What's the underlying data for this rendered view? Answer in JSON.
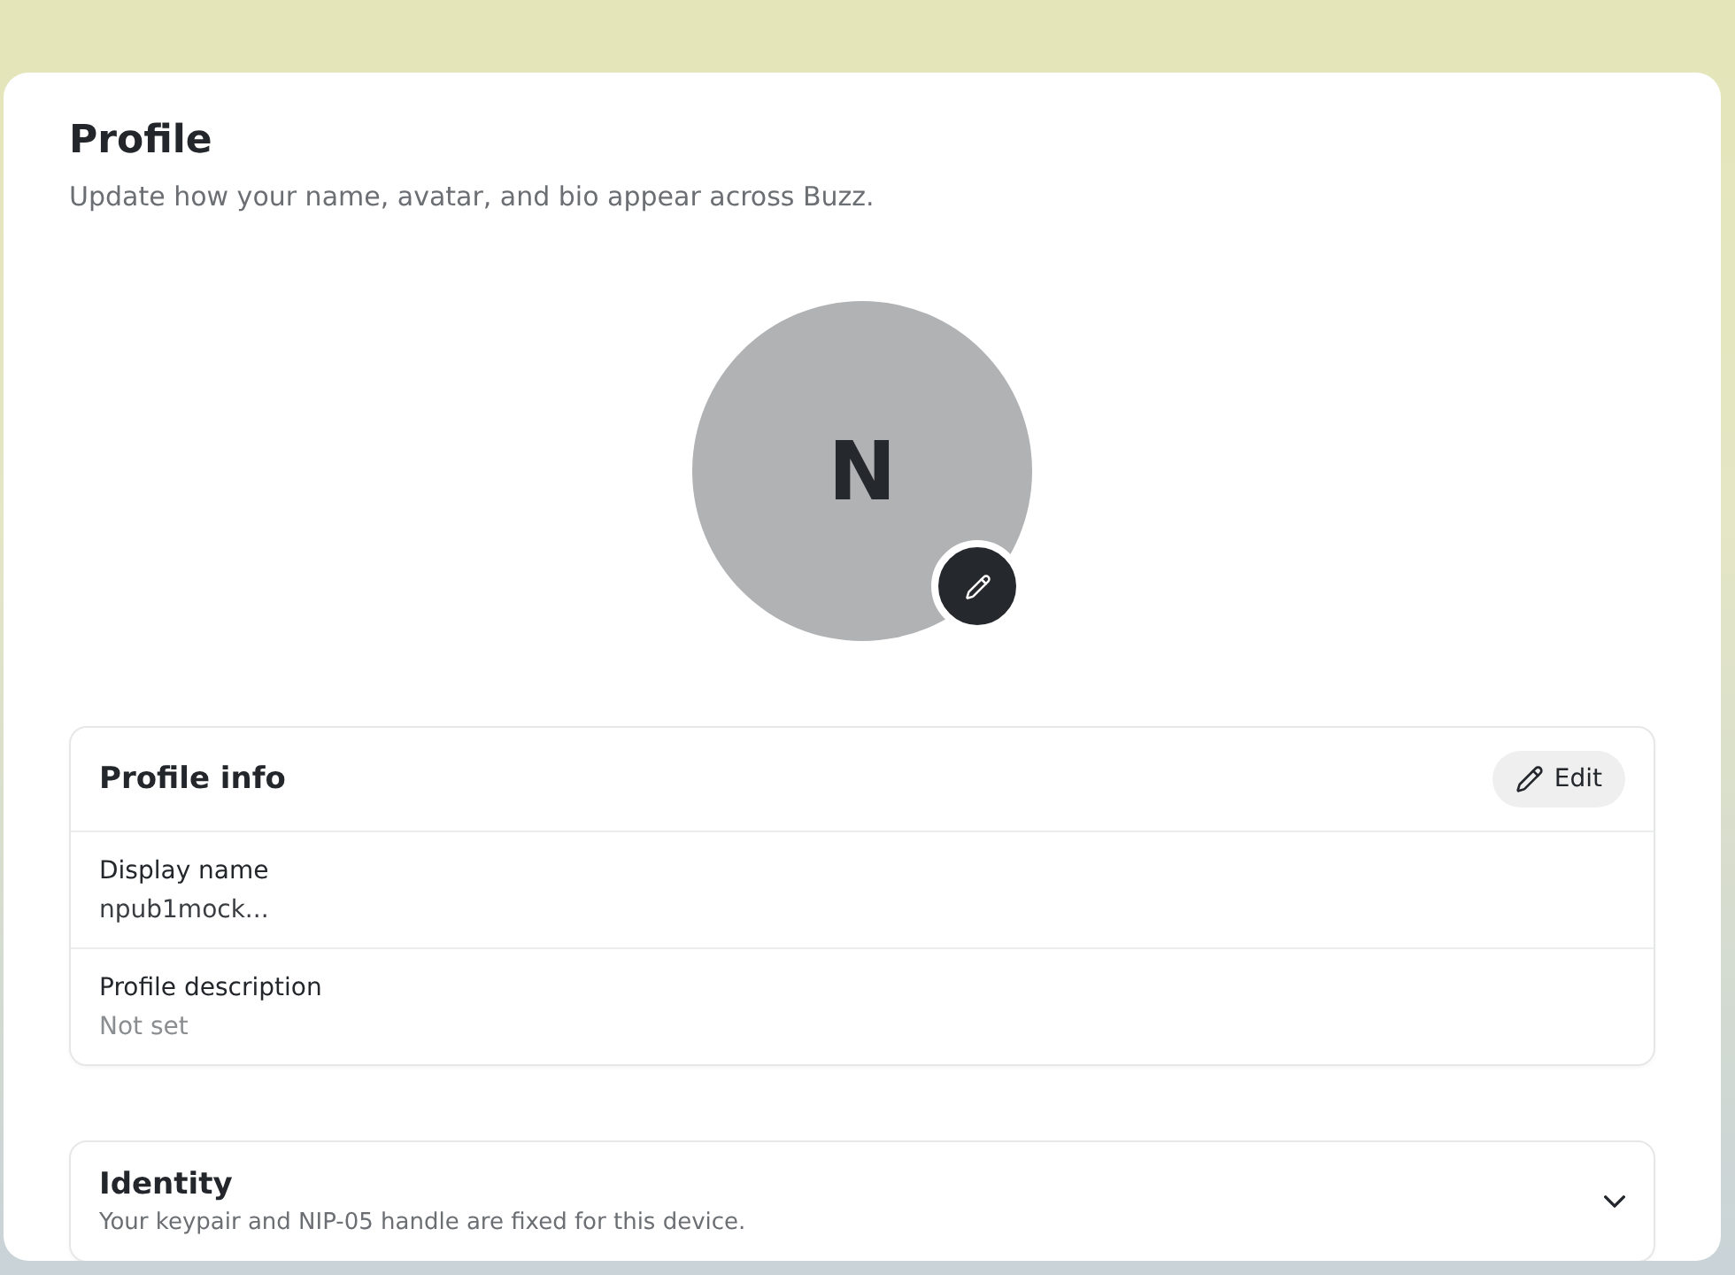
{
  "header": {
    "title": "Profile",
    "subtitle": "Update how your name, avatar, and bio appear across Buzz."
  },
  "avatar": {
    "initial": "N"
  },
  "profile_info": {
    "title": "Profile info",
    "edit_button": "Edit",
    "fields": [
      {
        "label": "Display name",
        "value": "npub1mock...",
        "is_set": true
      },
      {
        "label": "Profile description",
        "value": "Not set",
        "is_set": false
      }
    ]
  },
  "identity": {
    "title": "Identity",
    "subtitle": "Your keypair and NIP-05 handle are fixed for this device.",
    "expanded": false
  }
}
